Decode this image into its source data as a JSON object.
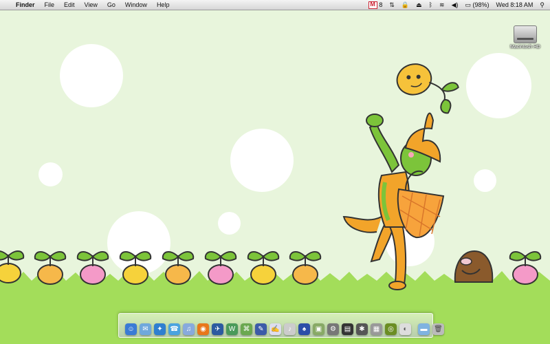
{
  "menubar": {
    "apple_glyph": "",
    "items": [
      "Finder",
      "File",
      "Edit",
      "View",
      "Go",
      "Window",
      "Help"
    ],
    "status": {
      "gmail_count": "8",
      "battery": "(98%)",
      "clock": "Wed 8:18 AM"
    }
  },
  "desktop": {
    "hd_label": "Macintosh HD"
  },
  "colors": {
    "background": "#e8f5dc",
    "grass": "#a3dd5a",
    "sprout_leaf": "#7cc43a"
  },
  "dock": {
    "icons": [
      "finder-icon",
      "mail-icon",
      "safari-icon",
      "ichat-icon",
      "itunes-icon",
      "firefox-icon",
      "thunderbird-icon",
      "dictionary-icon",
      "preview-icon",
      "textedit-icon",
      "app-icon",
      "app-icon",
      "app-icon",
      "app-icon",
      "app-icon",
      "app-icon",
      "app-icon",
      "app-icon",
      "app-icon",
      "app-icon",
      "folder-icon",
      "trash-icon"
    ]
  }
}
